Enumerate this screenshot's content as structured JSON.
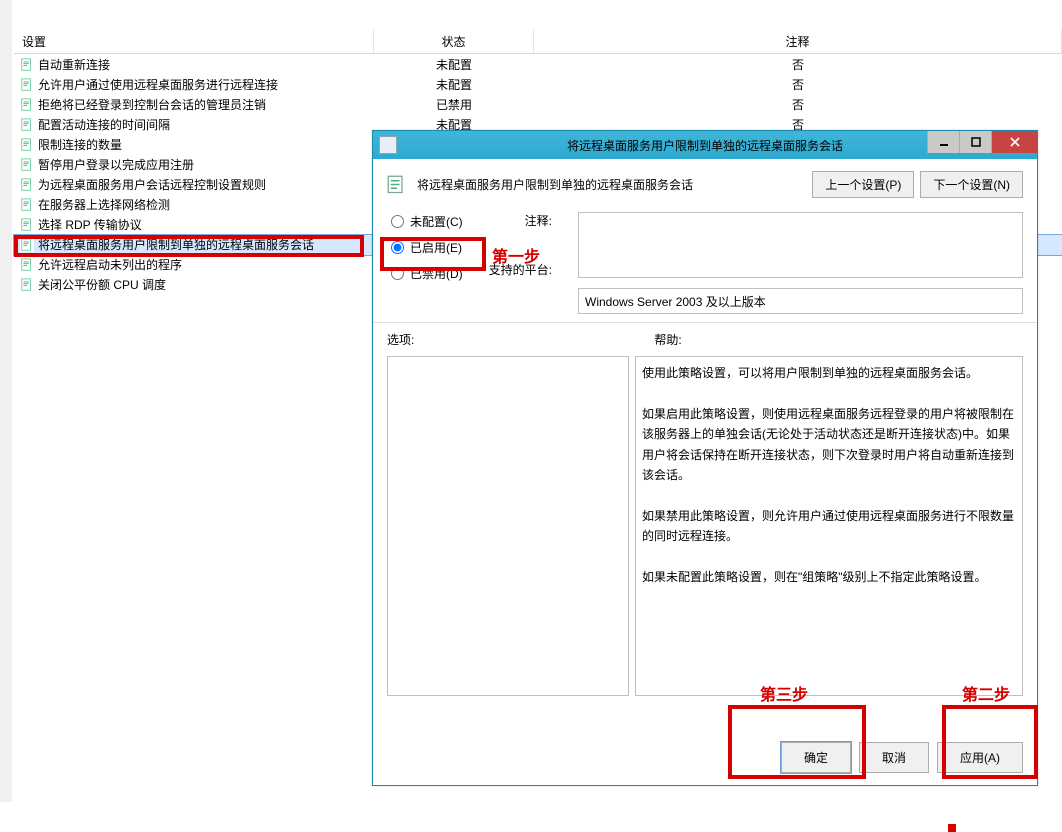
{
  "list": {
    "headers": {
      "name": "设置",
      "state": "状态",
      "comment": "注释"
    },
    "rows": [
      {
        "name": "自动重新连接",
        "state": "未配置",
        "comment": "否"
      },
      {
        "name": "允许用户通过使用远程桌面服务进行远程连接",
        "state": "未配置",
        "comment": "否"
      },
      {
        "name": "拒绝将已经登录到控制台会话的管理员注销",
        "state": "已禁用",
        "comment": "否"
      },
      {
        "name": "配置活动连接的时间间隔",
        "state": "未配置",
        "comment": "否"
      },
      {
        "name": "限制连接的数量",
        "state": "",
        "comment": ""
      },
      {
        "name": "暂停用户登录以完成应用注册",
        "state": "",
        "comment": ""
      },
      {
        "name": "为远程桌面服务用户会话远程控制设置规则",
        "state": "",
        "comment": ""
      },
      {
        "name": "在服务器上选择网络检测",
        "state": "",
        "comment": ""
      },
      {
        "name": "选择 RDP 传输协议",
        "state": "",
        "comment": ""
      },
      {
        "name": "将远程桌面服务用户限制到单独的远程桌面服务会话",
        "state": "",
        "comment": "",
        "selected": true
      },
      {
        "name": "允许远程启动未列出的程序",
        "state": "",
        "comment": ""
      },
      {
        "name": "关闭公平份额 CPU 调度",
        "state": "",
        "comment": ""
      }
    ]
  },
  "dialog": {
    "title": "将远程桌面服务用户限制到单独的远程桌面服务会话",
    "policy_label": "将远程桌面服务用户限制到单独的远程桌面服务会话",
    "nav": {
      "prev": "上一个设置(P)",
      "next": "下一个设置(N)"
    },
    "radios": {
      "not_configured": "未配置(C)",
      "enabled": "已启用(E)",
      "disabled": "已禁用(D)",
      "selected": "enabled"
    },
    "labels": {
      "comment": "注释:",
      "platform": "支持的平台:",
      "options": "选项:",
      "help": "帮助:"
    },
    "platform_text": "Windows Server 2003 及以上版本",
    "help_text_1": "使用此策略设置，可以将用户限制到单独的远程桌面服务会话。",
    "help_text_2": "如果启用此策略设置，则使用远程桌面服务远程登录的用户将被限制在该服务器上的单独会话(无论处于活动状态还是断开连接状态)中。如果用户将会话保持在断开连接状态，则下次登录时用户将自动重新连接到该会话。",
    "help_text_3": "如果禁用此策略设置，则允许用户通过使用远程桌面服务进行不限数量的同时远程连接。",
    "help_text_4": "如果未配置此策略设置，则在\"组策略\"级别上不指定此策略设置。",
    "buttons": {
      "ok": "确定",
      "cancel": "取消",
      "apply": "应用(A)"
    }
  },
  "annotations": {
    "step1": "第一步",
    "step2": "第二步",
    "step3": "第三步"
  }
}
